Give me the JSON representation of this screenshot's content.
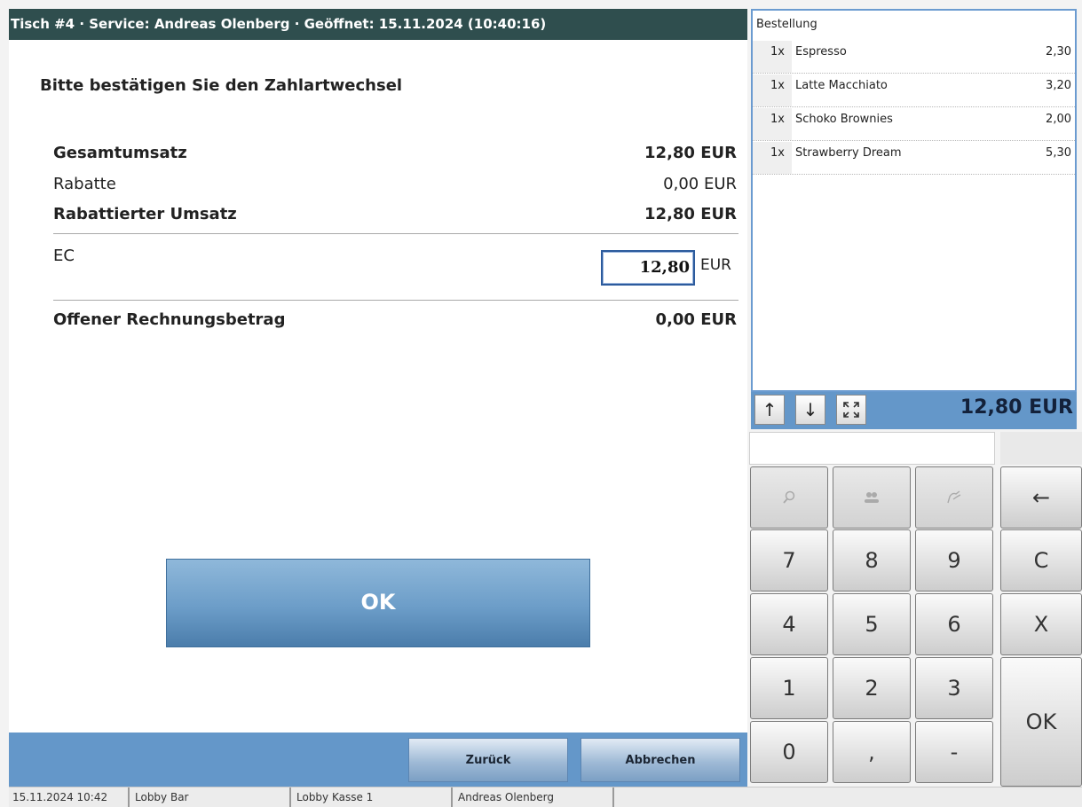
{
  "window": {
    "title": "Tisch #4 · Service: Andreas Olenberg · Geöffnet: 15.11.2024 (10:40:16)"
  },
  "payment": {
    "heading": "Bitte bestätigen Sie den Zahlartwechsel",
    "total_label": "Gesamtumsatz",
    "total_value": "12,80 EUR",
    "discount_label": "Rabatte",
    "discount_value": "0,00 EUR",
    "discounted_label": "Rabattierter Umsatz",
    "discounted_value": "12,80 EUR",
    "method_label": "EC",
    "method_amount": "12,80",
    "method_currency": "EUR",
    "open_label": "Offener Rechnungsbetrag",
    "open_value": "0,00 EUR",
    "ok_label": "OK"
  },
  "footer_buttons": {
    "back_label": "Zurück",
    "cancel_label": "Abbrechen"
  },
  "order": {
    "heading": "Bestellung",
    "items": [
      {
        "qty": "1x",
        "name": "Espresso",
        "price": "2,30"
      },
      {
        "qty": "1x",
        "name": "Latte Macchiato",
        "price": "3,20"
      },
      {
        "qty": "1x",
        "name": "Schoko Brownies",
        "price": "2,00"
      },
      {
        "qty": "1x",
        "name": "Strawberry Dream",
        "price": "5,30"
      }
    ],
    "total": "12,80 EUR",
    "controls": {
      "up": "↑",
      "down": "↓",
      "expand_icon": "expand-icon"
    }
  },
  "keypad": {
    "search_icon": "search-icon",
    "guests_icon": "guests-icon",
    "sign_icon": "signature-icon",
    "backspace": "←",
    "keys": [
      "7",
      "8",
      "9",
      "C",
      "4",
      "5",
      "6",
      "X",
      "1",
      "2",
      "3",
      "OK",
      "0",
      ",",
      "-"
    ]
  },
  "statusbar": {
    "datetime": "15.11.2024 10:42",
    "location": "Lobby Bar",
    "register": "Lobby Kasse 1",
    "user": "Andreas Olenberg"
  },
  "colors": {
    "titlebar": "#2f4e4e",
    "accent_blue": "#6497c9",
    "ok_button": "#6c9dc8"
  }
}
